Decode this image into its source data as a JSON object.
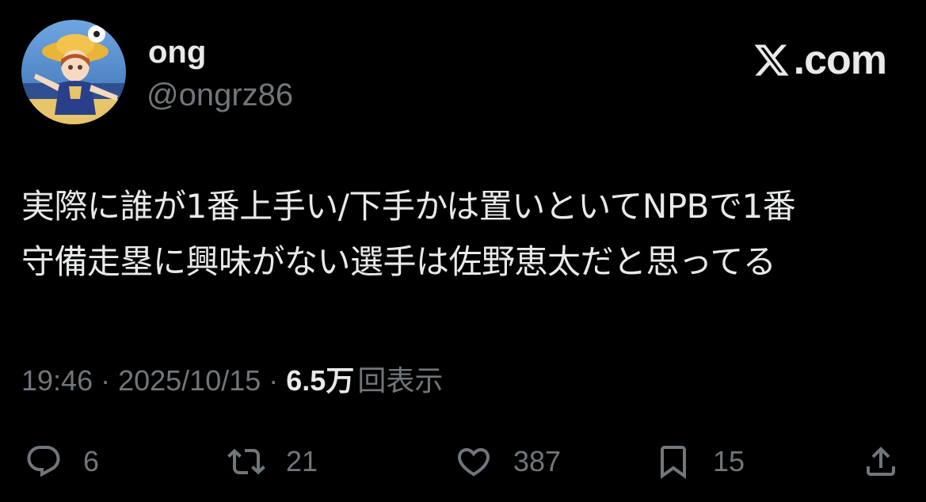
{
  "user": {
    "display_name": "ong",
    "handle": "@ongrz86",
    "avatar_icon": "anime-character-avatar"
  },
  "brand": {
    "text": ".com",
    "logo_icon": "x-logo-icon"
  },
  "tweet": {
    "lines": [
      "実際に誰が1番上手い/下手かは置いといてNPBで1番",
      "守備走塁に興味がない選手は佐野恵太だと思ってる"
    ]
  },
  "meta": {
    "time": "19:46",
    "separator": "·",
    "date": "2025/10/15",
    "views_count": "6.5万",
    "views_label": "回表示"
  },
  "actions": {
    "reply": {
      "icon": "reply-icon",
      "count": "6"
    },
    "retweet": {
      "icon": "retweet-icon",
      "count": "21"
    },
    "like": {
      "icon": "heart-icon",
      "count": "387"
    },
    "bookmark": {
      "icon": "bookmark-icon",
      "count": "15"
    },
    "share": {
      "icon": "share-icon"
    }
  },
  "colors": {
    "background": "#000000",
    "text_primary": "#e7e9ea",
    "text_secondary": "#71767b"
  }
}
